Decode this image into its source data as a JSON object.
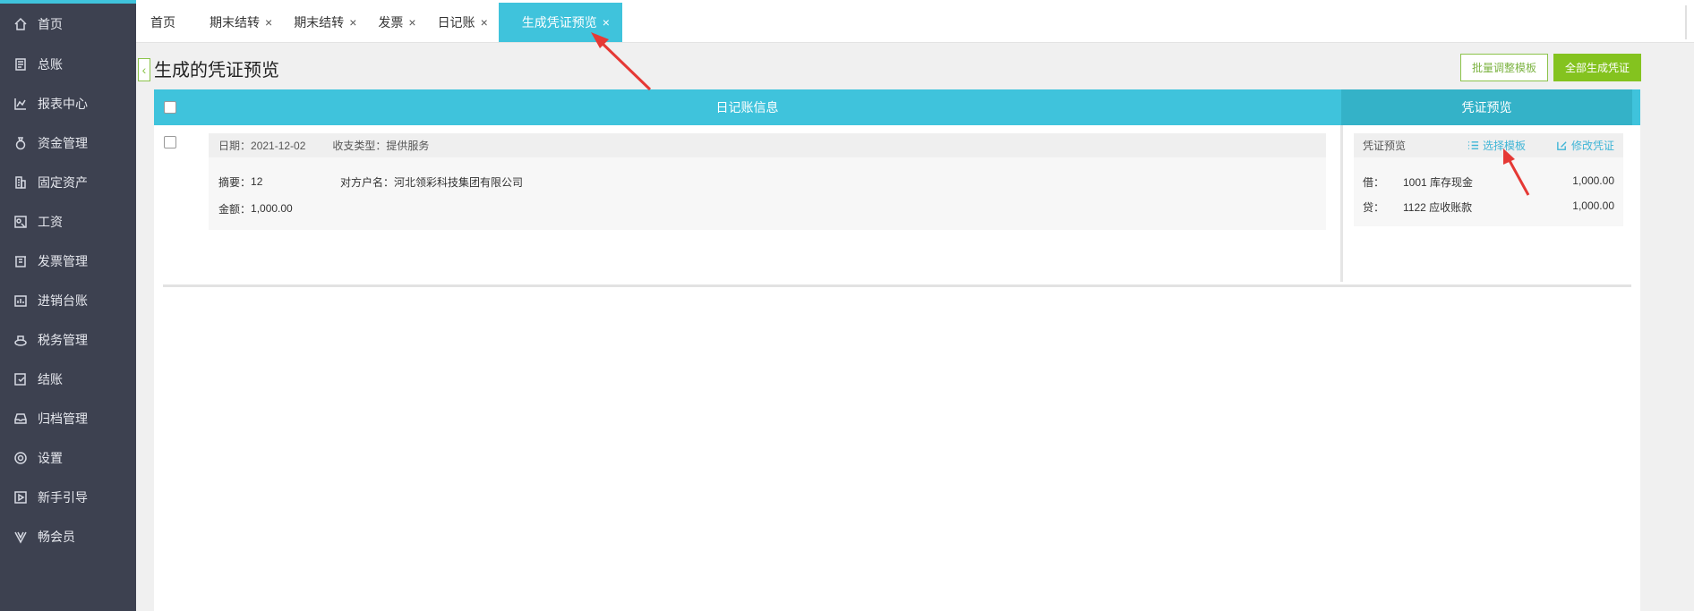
{
  "sidebar": {
    "items": [
      {
        "label": "首页",
        "icon": "home-icon"
      },
      {
        "label": "总账",
        "icon": "ledger-icon"
      },
      {
        "label": "报表中心",
        "icon": "chart-icon"
      },
      {
        "label": "资金管理",
        "icon": "money-bag-icon"
      },
      {
        "label": "固定资产",
        "icon": "building-icon"
      },
      {
        "label": "工资",
        "icon": "salary-icon"
      },
      {
        "label": "发票管理",
        "icon": "invoice-icon"
      },
      {
        "label": "进销台账",
        "icon": "inventory-icon"
      },
      {
        "label": "税务管理",
        "icon": "tax-icon"
      },
      {
        "label": "结账",
        "icon": "checkout-icon"
      },
      {
        "label": "归档管理",
        "icon": "archive-icon"
      },
      {
        "label": "设置",
        "icon": "gear-icon"
      },
      {
        "label": "新手引导",
        "icon": "play-guide-icon"
      },
      {
        "label": "畅会员",
        "icon": "vip-icon"
      }
    ]
  },
  "tabs": [
    {
      "label": "首页",
      "closable": false
    },
    {
      "label": "期末结转",
      "closable": true
    },
    {
      "label": "期末结转",
      "closable": true
    },
    {
      "label": "发票",
      "closable": true
    },
    {
      "label": "日记账",
      "closable": true
    },
    {
      "label": "生成凭证预览",
      "closable": true,
      "active": true
    }
  ],
  "page": {
    "title": "生成的凭证预览",
    "batch_adjust_label": "批量调整模板",
    "generate_all_label": "全部生成凭证"
  },
  "table": {
    "left_header": "日记账信息",
    "right_header": "凭证预览"
  },
  "journal": {
    "date_label": "日期：",
    "date": "2021-12-02",
    "type_label": "收支类型：",
    "type": "提供服务",
    "summary_label": "摘要：",
    "summary": "12",
    "counterparty_label": "对方户名：",
    "counterparty": "河北领彩科技集团有限公司",
    "amount_label": "金额：",
    "amount": "1,000.00"
  },
  "voucher": {
    "title": "凭证预览",
    "select_template_label": "选择模板",
    "edit_voucher_label": "修改凭证",
    "entries": [
      {
        "side": "借：",
        "account": "1001 库存现金",
        "amount": "1,000.00"
      },
      {
        "side": "贷：",
        "account": "1122 应收账款",
        "amount": "1,000.00"
      }
    ]
  },
  "colors": {
    "accent": "#3fc3dc",
    "sidebar_bg": "#3d4150",
    "green": "#84c31f",
    "annotation_arrow": "#e53935"
  }
}
